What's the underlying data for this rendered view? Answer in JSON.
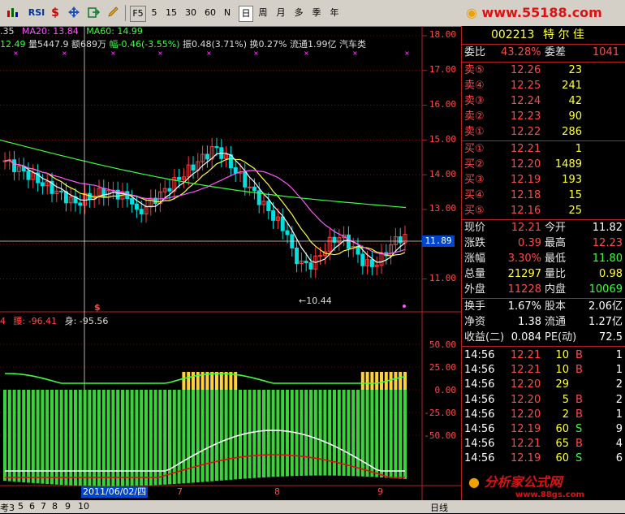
{
  "toolbar": {
    "rsi_label": "RSI",
    "buttons": [
      "F5",
      "5",
      "15",
      "30",
      "60",
      "N",
      "日",
      "周",
      "月",
      "多",
      "季",
      "年"
    ],
    "active": "日"
  },
  "logo_top": "www.55188.com",
  "logo_bottom": "分析家公式网",
  "logo_bottom_sub": "www.88gs.com",
  "info_line": {
    "ma_prefix": ".35",
    "ma20": "MA20: 13.84",
    "ma60": "MA60: 14.99",
    "price": "12.49",
    "vol": "量5447.9",
    "amount": "额689万",
    "change": "幅-0.46(-3.55%)",
    "amplitude": "振0.48(3.71%)",
    "turnover": "换0.27%",
    "float": "流通1.99亿",
    "sector": "汽车类"
  },
  "price_axis": [
    "18.00",
    "17.00",
    "16.00",
    "15.00",
    "14.00",
    "13.00",
    "12.00",
    "11.00"
  ],
  "price_cursor": "11.89",
  "low_annotation": "←10.44",
  "indicator_info": {
    "a": "4",
    "b": "腰: -96.41",
    "c": "身: -95.56"
  },
  "indicator_axis": [
    "50.00",
    "25.00",
    "0.00",
    "-25.00",
    "-50.00"
  ],
  "date_label": "2011/06/02/四",
  "x_ticks": [
    "7",
    "8",
    "9"
  ],
  "bottom_tabs": [
    "考3",
    "5",
    "6",
    "7",
    "8",
    "9",
    "10"
  ],
  "bottom_right": "日线",
  "colors": {
    "up": "#ff3c3c",
    "down": "#00e0e0",
    "ma5": "#ffffff",
    "ma10": "#ffff3c",
    "ma20": "#ff55ff",
    "ma60": "#3cff3c",
    "grid": "#b22222"
  },
  "quote": {
    "code": "002213",
    "name": "特 尔 佳",
    "weibi_label": "委比",
    "weibi": "43.28%",
    "weicha_label": "委差",
    "weicha": "1041",
    "asks": [
      {
        "label": "卖⑤",
        "price": "12.26",
        "vol": "23"
      },
      {
        "label": "卖④",
        "price": "12.25",
        "vol": "241"
      },
      {
        "label": "卖③",
        "price": "12.24",
        "vol": "42"
      },
      {
        "label": "卖②",
        "price": "12.23",
        "vol": "90"
      },
      {
        "label": "卖①",
        "price": "12.22",
        "vol": "286"
      }
    ],
    "bids": [
      {
        "label": "买①",
        "price": "12.21",
        "vol": "1"
      },
      {
        "label": "买②",
        "price": "12.20",
        "vol": "1489"
      },
      {
        "label": "买③",
        "price": "12.19",
        "vol": "193"
      },
      {
        "label": "买④",
        "price": "12.18",
        "vol": "15"
      },
      {
        "label": "买⑤",
        "price": "12.16",
        "vol": "25"
      }
    ],
    "stats": [
      {
        "l1": "现价",
        "v1": "12.21",
        "l2": "今开",
        "v2": "11.82",
        "c1": "red",
        "c2": "white"
      },
      {
        "l1": "涨跌",
        "v1": "0.39",
        "l2": "最高",
        "v2": "12.23",
        "c1": "red",
        "c2": "red"
      },
      {
        "l1": "涨幅",
        "v1": "3.30%",
        "l2": "最低",
        "v2": "11.80",
        "c1": "red",
        "c2": "green"
      },
      {
        "l1": "总量",
        "v1": "21297",
        "l2": "量比",
        "v2": "0.98",
        "c1": "yellow",
        "c2": "yellow"
      },
      {
        "l1": "外盘",
        "v1": "11228",
        "l2": "内盘",
        "v2": "10069",
        "c1": "red",
        "c2": "green"
      }
    ],
    "fundamentals": [
      {
        "l1": "换手",
        "v1": "1.67%",
        "l2": "股本",
        "v2": "2.06亿"
      },
      {
        "l1": "净资",
        "v1": "1.38",
        "l2": "流通",
        "v2": "1.27亿"
      },
      {
        "l1": "收益(二)",
        "v1": "0.084",
        "l2": "PE(动)",
        "v2": "72.5"
      }
    ],
    "ticks": [
      {
        "time": "14:56",
        "price": "12.21",
        "vol": "10",
        "side": "B",
        "n": "1"
      },
      {
        "time": "14:56",
        "price": "12.21",
        "vol": "10",
        "side": "B",
        "n": "1"
      },
      {
        "time": "14:56",
        "price": "12.20",
        "vol": "29",
        "side": "",
        "n": "2"
      },
      {
        "time": "14:56",
        "price": "12.20",
        "vol": "5",
        "side": "B",
        "n": "2"
      },
      {
        "time": "14:56",
        "price": "12.20",
        "vol": "2",
        "side": "B",
        "n": "1"
      },
      {
        "time": "14:56",
        "price": "12.19",
        "vol": "60",
        "side": "S",
        "n": "9"
      },
      {
        "time": "14:56",
        "price": "12.21",
        "vol": "65",
        "side": "B",
        "n": "4"
      },
      {
        "time": "14:56",
        "price": "12.19",
        "vol": "60",
        "side": "S",
        "n": "6"
      }
    ]
  }
}
